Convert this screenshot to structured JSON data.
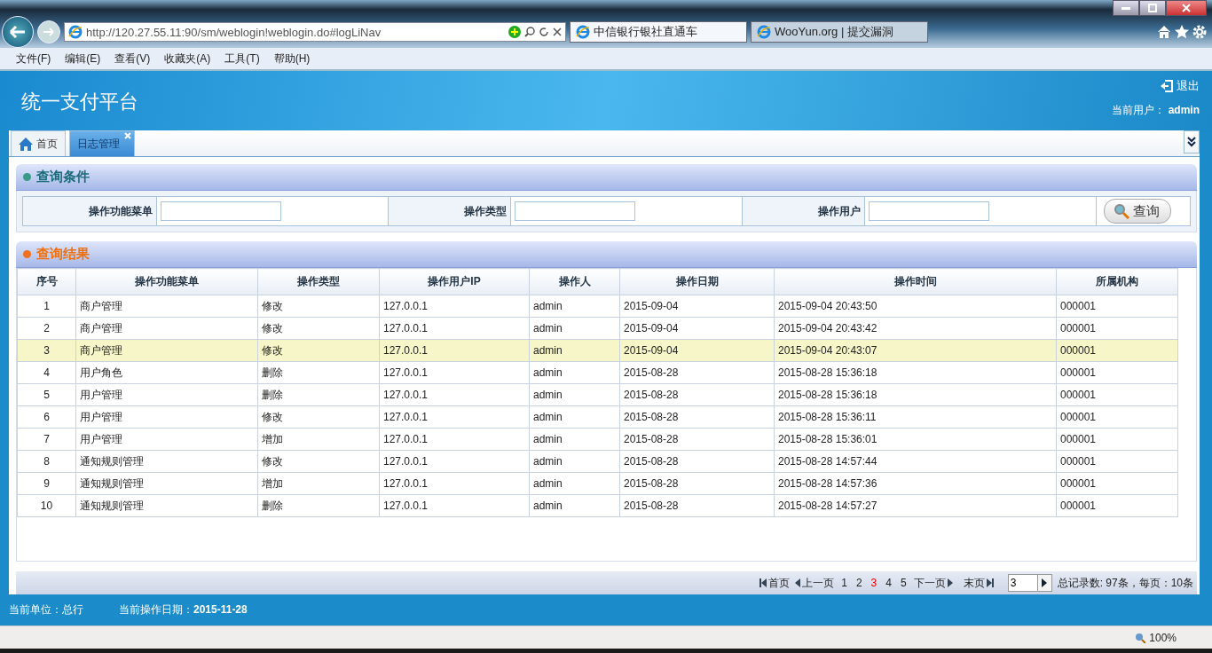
{
  "browser": {
    "url": "http://120.27.55.11:90/sm/weblogin!weblogin.do#logLiNav",
    "tabs": [
      {
        "title": "中信银行银社直通车",
        "selected": true
      },
      {
        "title": "WooYun.org | 提交漏洞",
        "selected": false
      }
    ],
    "menu": [
      "文件(F)",
      "编辑(E)",
      "查看(V)",
      "收藏夹(A)",
      "工具(T)",
      "帮助(H)"
    ],
    "zoom": "100%"
  },
  "header": {
    "title": "统一支付平台",
    "logout": "退出",
    "user_label": "当前用户：",
    "user": "admin"
  },
  "tabs": [
    {
      "label": "首页",
      "kind": "home",
      "selected": false
    },
    {
      "label": "日志管理",
      "kind": "closable",
      "selected": true
    }
  ],
  "query": {
    "title": "查询条件",
    "fields": [
      {
        "label": "操作功能菜单"
      },
      {
        "label": "操作类型"
      },
      {
        "label": "操作用户"
      }
    ],
    "button": "查询"
  },
  "results": {
    "title": "查询结果",
    "columns": [
      "序号",
      "操作功能菜单",
      "操作类型",
      "操作用户IP",
      "操作人",
      "操作日期",
      "操作时间",
      "所属机构"
    ],
    "rows": [
      {
        "cells": [
          "1",
          "商户管理",
          "修改",
          "127.0.0.1",
          "admin",
          "2015-09-04",
          "2015-09-04 20:43:50",
          "000001"
        ],
        "selected": false
      },
      {
        "cells": [
          "2",
          "商户管理",
          "修改",
          "127.0.0.1",
          "admin",
          "2015-09-04",
          "2015-09-04 20:43:42",
          "000001"
        ],
        "selected": false
      },
      {
        "cells": [
          "3",
          "商户管理",
          "修改",
          "127.0.0.1",
          "admin",
          "2015-09-04",
          "2015-09-04 20:43:07",
          "000001"
        ],
        "selected": true
      },
      {
        "cells": [
          "4",
          "用户角色",
          "删除",
          "127.0.0.1",
          "admin",
          "2015-08-28",
          "2015-08-28 15:36:18",
          "000001"
        ],
        "selected": false
      },
      {
        "cells": [
          "5",
          "用户管理",
          "删除",
          "127.0.0.1",
          "admin",
          "2015-08-28",
          "2015-08-28 15:36:18",
          "000001"
        ],
        "selected": false
      },
      {
        "cells": [
          "6",
          "用户管理",
          "修改",
          "127.0.0.1",
          "admin",
          "2015-08-28",
          "2015-08-28 15:36:11",
          "000001"
        ],
        "selected": false
      },
      {
        "cells": [
          "7",
          "用户管理",
          "增加",
          "127.0.0.1",
          "admin",
          "2015-08-28",
          "2015-08-28 15:36:01",
          "000001"
        ],
        "selected": false
      },
      {
        "cells": [
          "8",
          "通知规则管理",
          "修改",
          "127.0.0.1",
          "admin",
          "2015-08-28",
          "2015-08-28 14:57:44",
          "000001"
        ],
        "selected": false
      },
      {
        "cells": [
          "9",
          "通知规则管理",
          "增加",
          "127.0.0.1",
          "admin",
          "2015-08-28",
          "2015-08-28 14:57:36",
          "000001"
        ],
        "selected": false
      },
      {
        "cells": [
          "10",
          "通知规则管理",
          "删除",
          "127.0.0.1",
          "admin",
          "2015-08-28",
          "2015-08-28 14:57:27",
          "000001"
        ],
        "selected": false
      }
    ]
  },
  "pager": {
    "first": "首页",
    "prev": "上一页",
    "pages": [
      {
        "label": "1",
        "selected": false
      },
      {
        "label": "2",
        "selected": false
      },
      {
        "label": "3",
        "selected": true
      },
      {
        "label": "4",
        "selected": false
      },
      {
        "label": "5",
        "selected": false
      }
    ],
    "next": "下一页",
    "last": "末页",
    "page_value": "3",
    "summary": "总记录数: 97条，每页：10条"
  },
  "footer": {
    "unit_label": "当前单位：",
    "unit": "总行",
    "date_label": "当前操作日期：",
    "date": "2015-11-28"
  }
}
